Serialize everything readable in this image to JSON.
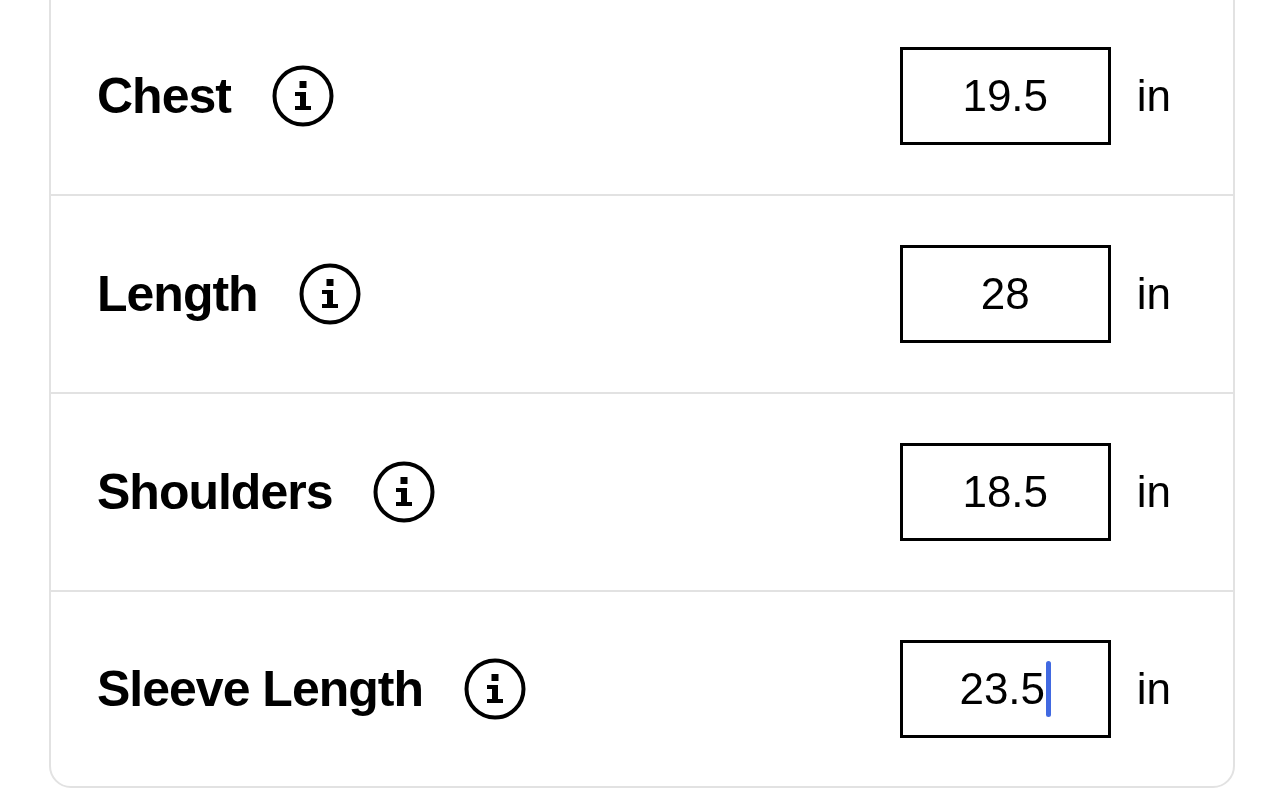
{
  "rows": [
    {
      "label": "Chest",
      "value": "19.5",
      "unit": "in",
      "focused": false
    },
    {
      "label": "Length",
      "value": "28",
      "unit": "in",
      "focused": false
    },
    {
      "label": "Shoulders",
      "value": "18.5",
      "unit": "in",
      "focused": false
    },
    {
      "label": "Sleeve Length",
      "value": "23.5",
      "unit": "in",
      "focused": true
    }
  ]
}
